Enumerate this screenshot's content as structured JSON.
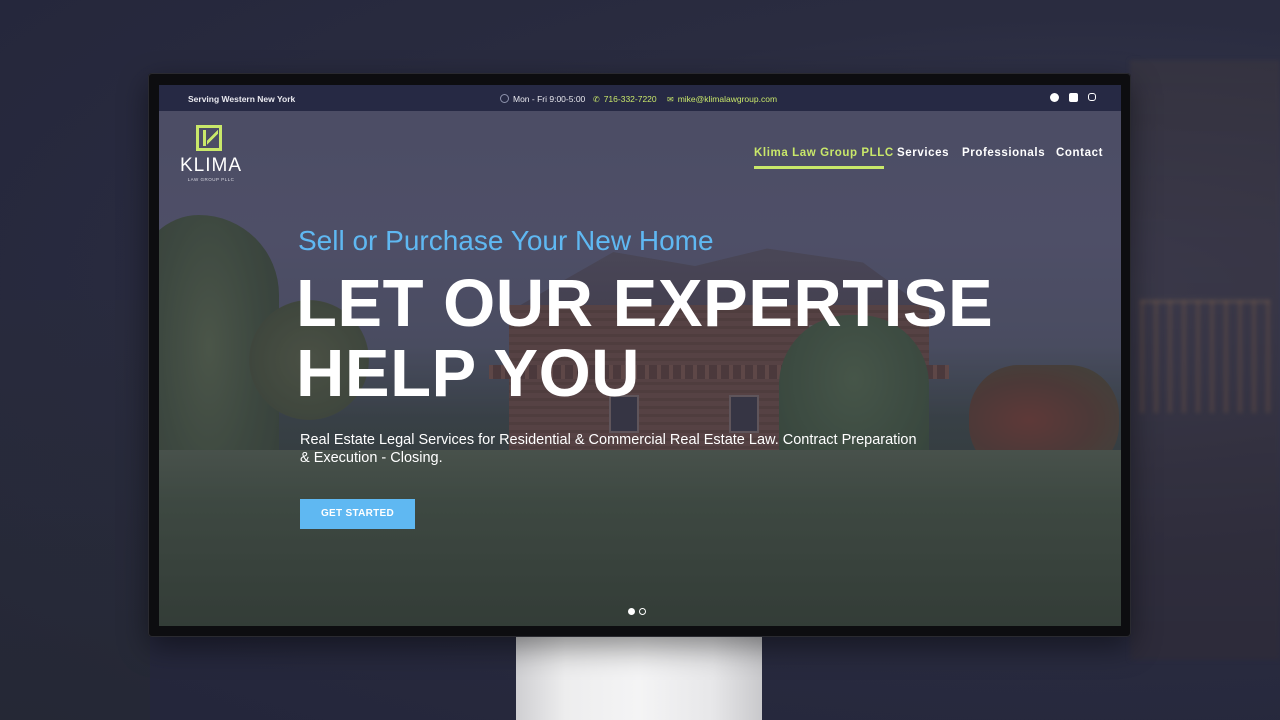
{
  "topbar": {
    "serving": "Serving Western New York",
    "hours": "Mon - Fri 9:00-5:00",
    "phone": "716-332-7220",
    "email": "mike@klimalawgroup.com",
    "social_icons": [
      "facebook-icon",
      "linkedin-icon",
      "instagram-icon"
    ]
  },
  "logo": {
    "wordmark": "KLIMA",
    "subtitle": "LAW GROUP PLLC"
  },
  "nav": {
    "items": [
      {
        "label": "Klima Law Group PLLC",
        "active": true
      },
      {
        "label": "Services",
        "active": false
      },
      {
        "label": "Professionals",
        "active": false
      },
      {
        "label": "Contact",
        "active": false
      }
    ]
  },
  "hero": {
    "kicker": "Sell or Purchase Your New Home",
    "headline_line1": "LET OUR EXPERTISE",
    "headline_line2": "HELP YOU",
    "description": "Real Estate Legal Services for Residential & Commercial Real Estate Law. Contract Preparation & Execution - Closing.",
    "cta_label": "GET STARTED",
    "slides_total": 2,
    "slide_active": 1
  },
  "colors": {
    "accent_green": "#c9e86a",
    "accent_blue": "#5fb8f2",
    "topbar_bg": "#262944"
  }
}
